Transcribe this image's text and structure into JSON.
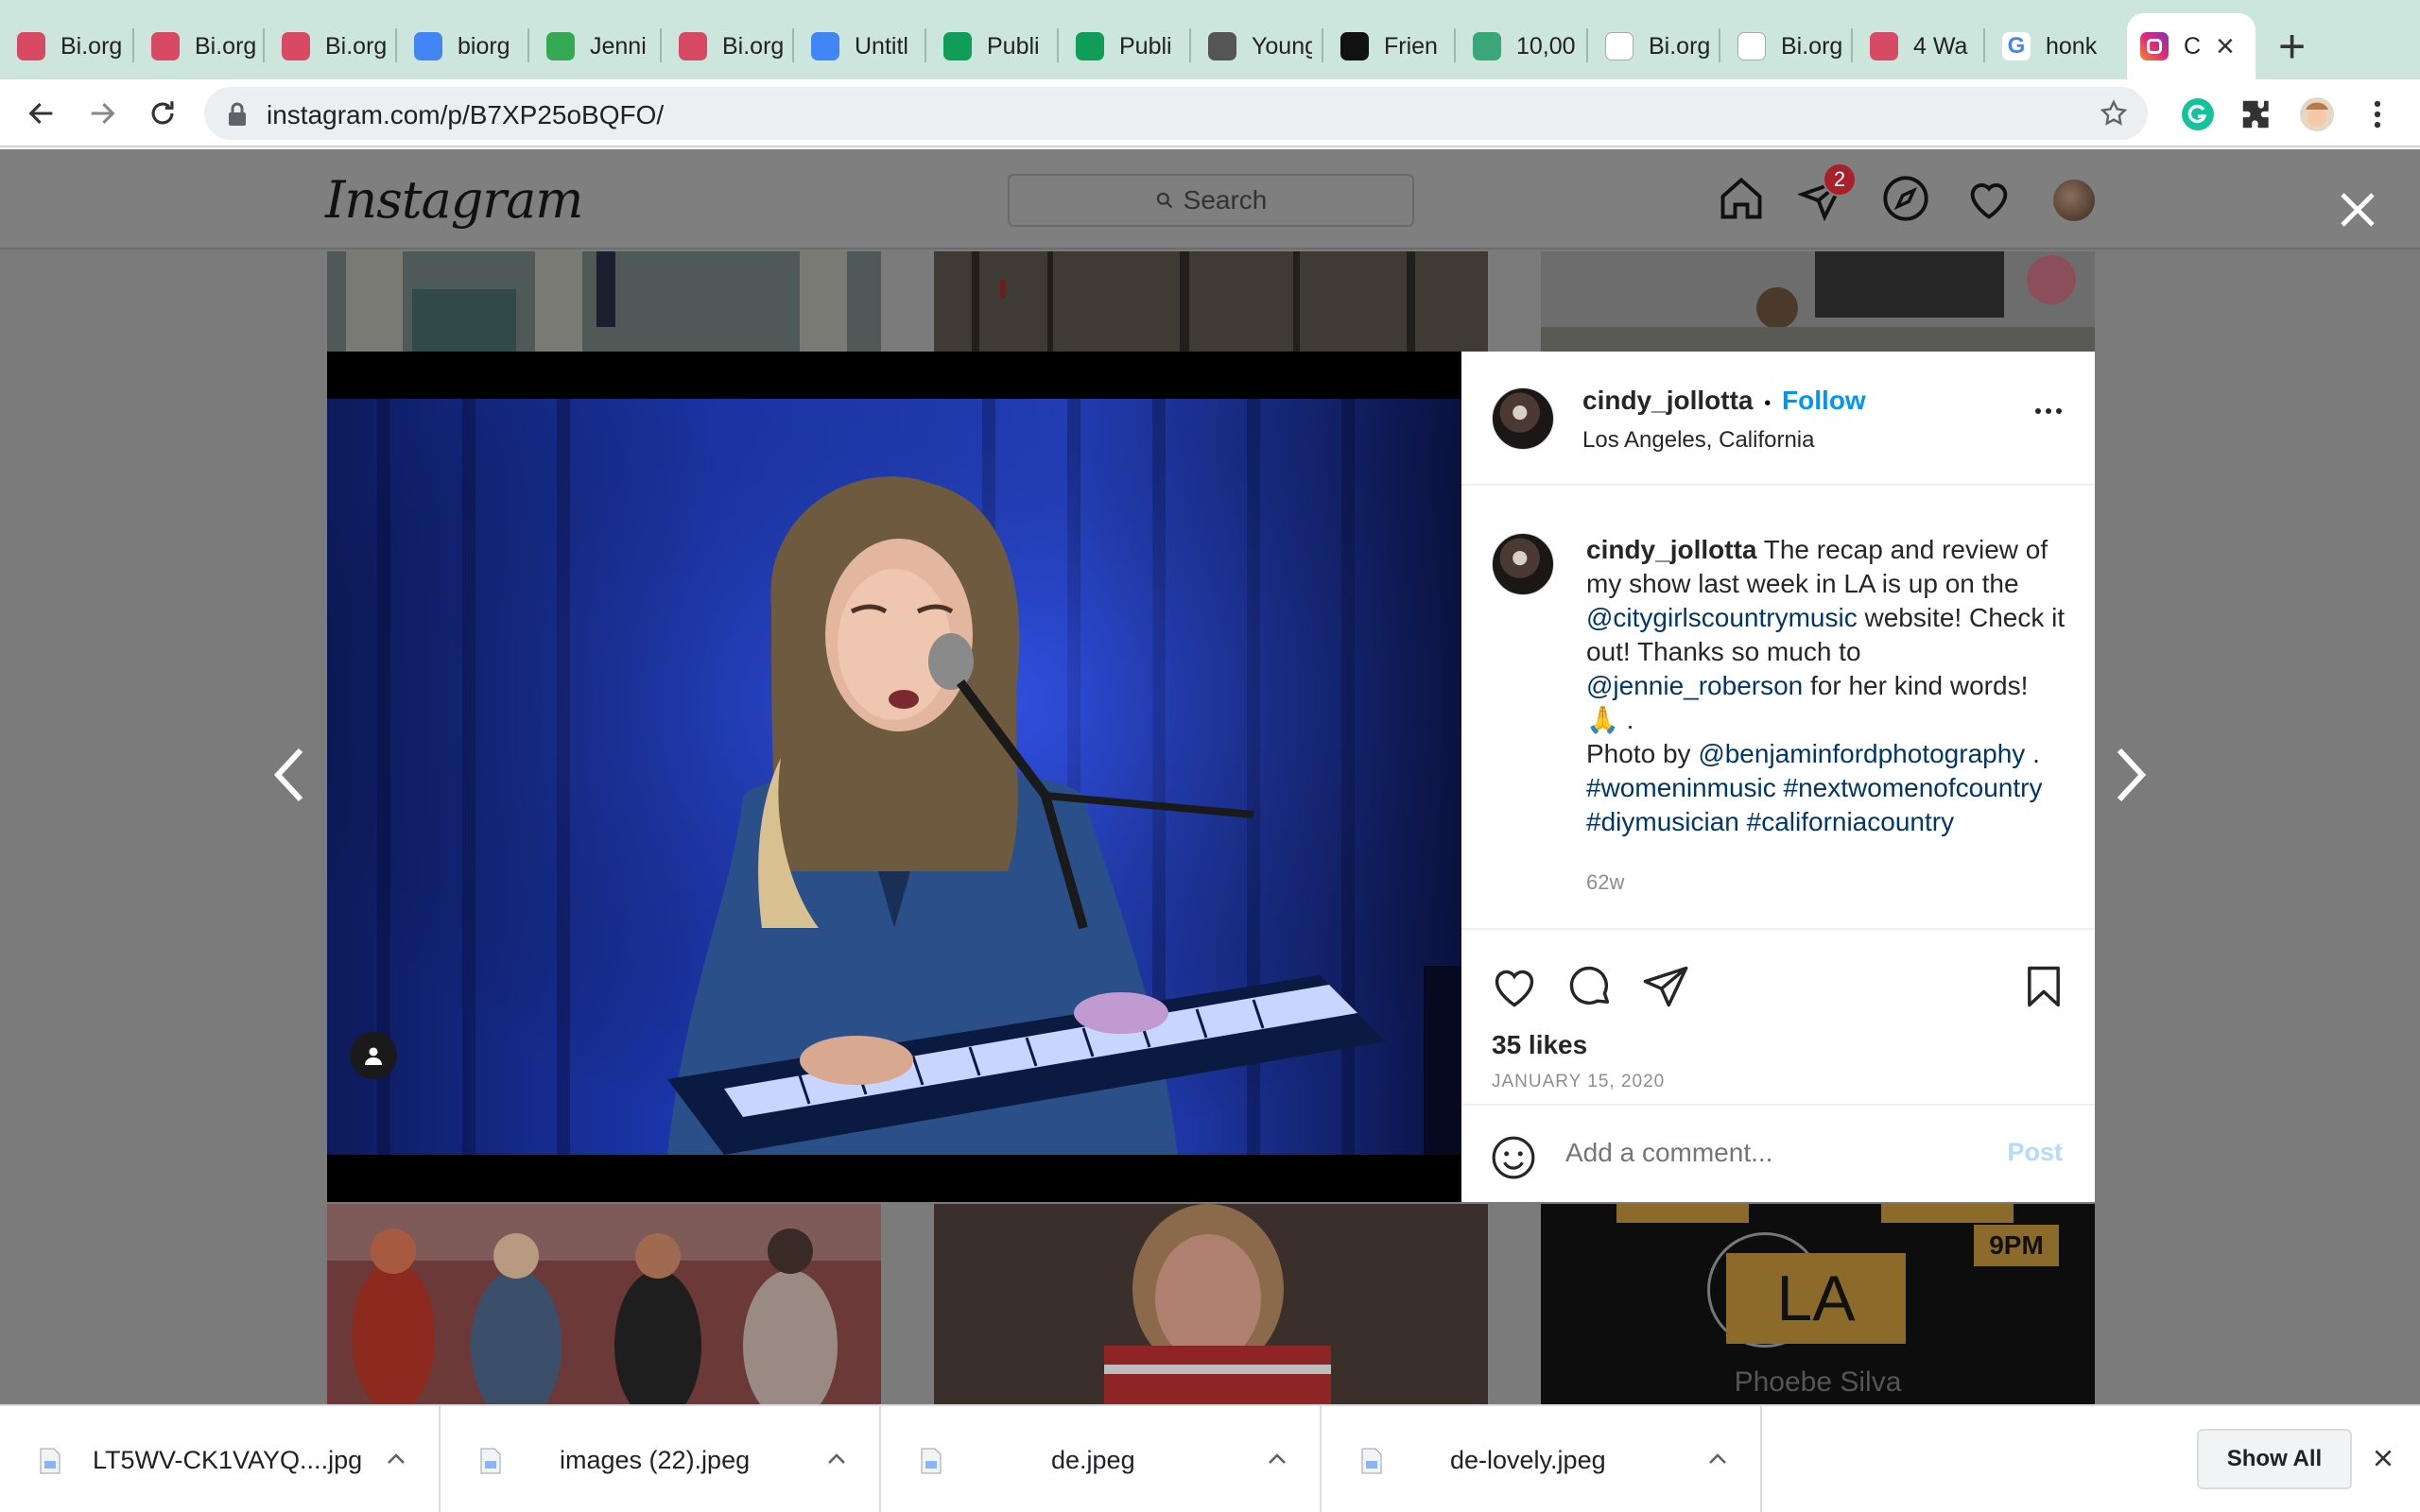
{
  "browser": {
    "tabs": [
      {
        "title": "Bi.org",
        "icon": "biorg-icon",
        "color": "#d84a63"
      },
      {
        "title": "Bi.org",
        "icon": "biorg-icon",
        "color": "#d84a63"
      },
      {
        "title": "Bi.org",
        "icon": "biorg-icon",
        "color": "#d84a63"
      },
      {
        "title": "biorg",
        "icon": "google-docs-icon",
        "color": "#4285f4"
      },
      {
        "title": "Jenni",
        "icon": "google-drive-icon",
        "color": "#34a853"
      },
      {
        "title": "Bi.org",
        "icon": "biorg-icon",
        "color": "#d84a63"
      },
      {
        "title": "Untitl",
        "icon": "google-docs-icon",
        "color": "#4285f4"
      },
      {
        "title": "Publi",
        "icon": "google-sheets-icon",
        "color": "#0f9d58"
      },
      {
        "title": "Publi",
        "icon": "google-sheets-icon",
        "color": "#0f9d58"
      },
      {
        "title": "Young",
        "icon": "globe-icon",
        "color": "#555555"
      },
      {
        "title": "Frien",
        "icon": "unsplash-icon",
        "color": "#111111"
      },
      {
        "title": "10,00",
        "icon": "doc-icon",
        "color": "#3aa679"
      },
      {
        "title": "Bi.org",
        "icon": "blank-page-icon",
        "color": "#dddddd"
      },
      {
        "title": "Bi.org",
        "icon": "blank-page-icon",
        "color": "#dddddd"
      },
      {
        "title": "4 Wa",
        "icon": "biorg-icon",
        "color": "#d84a63"
      },
      {
        "title": "honk",
        "icon": "google-icon",
        "color": "#ffffff"
      },
      {
        "title": "C",
        "icon": "instagram-icon",
        "color": "#d6249f",
        "active": true
      }
    ],
    "url": "instagram.com/p/B7XP25oBQFO/"
  },
  "instagram": {
    "logo": "Instagram",
    "search_placeholder": "Search",
    "notification_count": "2"
  },
  "post": {
    "username": "cindy_jollotta",
    "follow_separator": "•",
    "follow_label": "Follow",
    "location": "Los Angeles, California",
    "caption": {
      "text_1": "The recap and review of my show last week in LA is up on the",
      "mention_1": "@citygirlscountrymusic",
      "text_2": "website! Check it out! Thanks so much to",
      "mention_2": "@jennie_roberson",
      "text_3": "for her kind words!",
      "emoji_line": "🙏 .",
      "photo_by": "Photo by",
      "mention_3": "@benjaminfordphotography",
      "text_4": ".",
      "hashtags": "#womeninmusic #nextwomenofcountry #diymusician #californiacountry"
    },
    "time_ago": "62w",
    "likes": "35 likes",
    "date": "JANUARY 15, 2020",
    "comment_placeholder": "Add a comment...",
    "post_button": "Post"
  },
  "grid": {
    "flyer_time": "9PM",
    "flyer_city": "LA",
    "flyer_name": "Phoebe Silva"
  },
  "downloads": {
    "items": [
      {
        "name": "LT5WV-CK1VAYQ....jpg"
      },
      {
        "name": "images (22).jpeg"
      },
      {
        "name": "de.jpeg"
      },
      {
        "name": "de-lovely.jpeg"
      }
    ],
    "show_all": "Show All"
  }
}
